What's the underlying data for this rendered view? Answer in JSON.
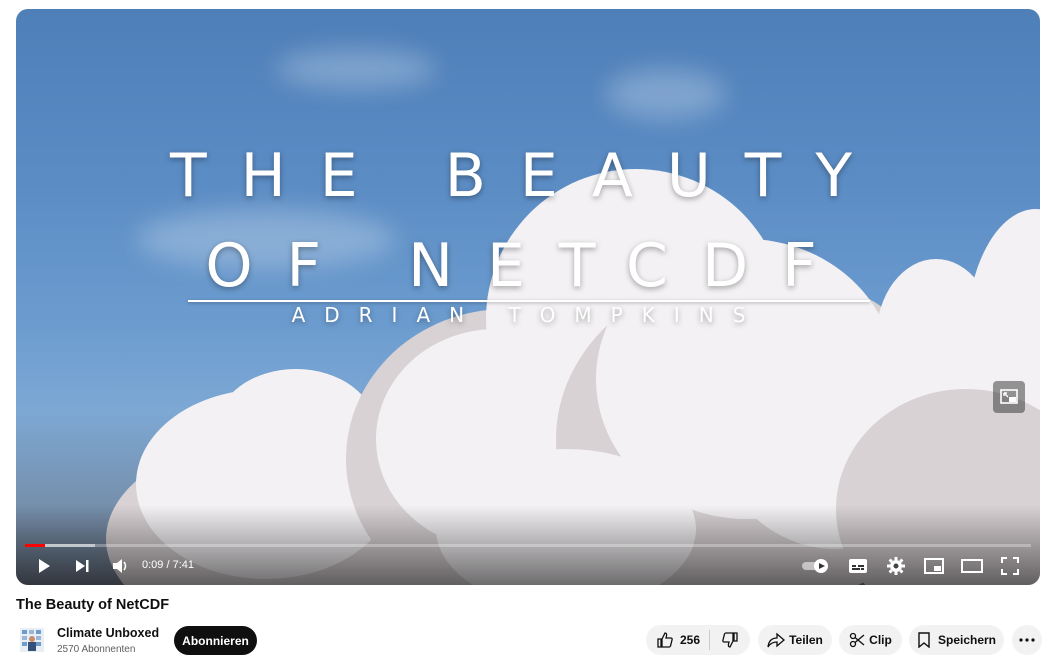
{
  "video": {
    "overlay_line1": "THE BEAUTY",
    "overlay_line2": "OF NETCDF",
    "overlay_line3": "ADRIAN TOMPKINS",
    "time_current": "0:09",
    "time_separator": " / ",
    "time_total": "7:41",
    "progress_played": 0.02,
    "progress_buffered": 0.07
  },
  "title": "The Beauty of NetCDF",
  "channel": {
    "name": "Climate Unboxed",
    "subscribers": "2570 Abonnenten",
    "subscribe_label": "Abonnieren"
  },
  "actions": {
    "like_count": "256",
    "share_label": "Teilen",
    "clip_label": "Clip",
    "save_label": "Speichern"
  },
  "icons": [
    "play-icon",
    "next-icon",
    "volume-icon",
    "autoplay-toggle-icon",
    "subtitles-icon",
    "settings-icon",
    "miniplayer-icon",
    "theater-mode-icon",
    "fullscreen-icon",
    "like-icon",
    "dislike-icon",
    "share-icon",
    "clip-icon",
    "save-icon",
    "more-icon"
  ],
  "colors": {
    "progress_played": "#ff0000",
    "subscribe_bg": "#0f0f0f",
    "pill_bg": "#f2f2f2"
  }
}
